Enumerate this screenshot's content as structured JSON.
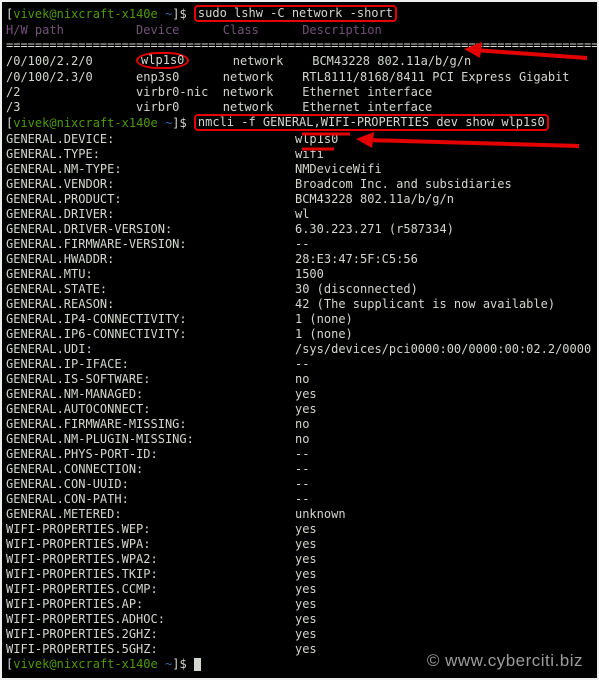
{
  "prompt1": {
    "user": "vivek",
    "host": "nixcraft-x140e",
    "dir": "~",
    "cmd": "sudo lshw -C network -short"
  },
  "lshw": {
    "header": {
      "hwpath": "H/W path",
      "device": "Device",
      "class": "Class",
      "desc": "Description"
    },
    "rows": [
      {
        "hwpath": "/0/100/2.2/0",
        "device": "wlp1s0",
        "class": "network",
        "desc": "BCM43228 802.11a/b/g/n",
        "hilite_dev": true
      },
      {
        "hwpath": "/0/100/2.3/0",
        "device": "enp3s0",
        "class": "network",
        "desc": "RTL8111/8168/8411 PCI Express Gigabit"
      },
      {
        "hwpath": "/2",
        "device": "virbr0-nic",
        "class": "network",
        "desc": "Ethernet interface"
      },
      {
        "hwpath": "/3",
        "device": "virbr0",
        "class": "network",
        "desc": "Ethernet interface"
      }
    ]
  },
  "prompt2": {
    "user": "vivek",
    "host": "nixcraft-x140e",
    "dir": "~",
    "cmd": "nmcli -f GENERAL,WIFI-PROPERTIES dev show wlp1s0"
  },
  "nmcli": [
    {
      "k": "GENERAL.DEVICE:",
      "v": "wlp1s0",
      "hilite_v": true
    },
    {
      "k": "GENERAL.TYPE:",
      "v": "wifi",
      "hilite_v": true
    },
    {
      "k": "GENERAL.NM-TYPE:",
      "v": "NMDeviceWifi"
    },
    {
      "k": "GENERAL.VENDOR:",
      "v": "Broadcom Inc. and subsidiaries"
    },
    {
      "k": "GENERAL.PRODUCT:",
      "v": "BCM43228 802.11a/b/g/n"
    },
    {
      "k": "GENERAL.DRIVER:",
      "v": "wl"
    },
    {
      "k": "GENERAL.DRIVER-VERSION:",
      "v": "6.30.223.271 (r587334)"
    },
    {
      "k": "GENERAL.FIRMWARE-VERSION:",
      "v": "--"
    },
    {
      "k": "GENERAL.HWADDR:",
      "v": "28:E3:47:5F:C5:56"
    },
    {
      "k": "GENERAL.MTU:",
      "v": "1500"
    },
    {
      "k": "GENERAL.STATE:",
      "v": "30 (disconnected)"
    },
    {
      "k": "GENERAL.REASON:",
      "v": "42 (The supplicant is now available)"
    },
    {
      "k": "GENERAL.IP4-CONNECTIVITY:",
      "v": "1 (none)"
    },
    {
      "k": "GENERAL.IP6-CONNECTIVITY:",
      "v": "1 (none)"
    },
    {
      "k": "GENERAL.UDI:",
      "v": "/sys/devices/pci0000:00/0000:00:02.2/0000"
    },
    {
      "k": "GENERAL.IP-IFACE:",
      "v": "--"
    },
    {
      "k": "GENERAL.IS-SOFTWARE:",
      "v": "no"
    },
    {
      "k": "GENERAL.NM-MANAGED:",
      "v": "yes"
    },
    {
      "k": "GENERAL.AUTOCONNECT:",
      "v": "yes"
    },
    {
      "k": "GENERAL.FIRMWARE-MISSING:",
      "v": "no"
    },
    {
      "k": "GENERAL.NM-PLUGIN-MISSING:",
      "v": "no"
    },
    {
      "k": "GENERAL.PHYS-PORT-ID:",
      "v": "--"
    },
    {
      "k": "GENERAL.CONNECTION:",
      "v": "--"
    },
    {
      "k": "GENERAL.CON-UUID:",
      "v": "--"
    },
    {
      "k": "GENERAL.CON-PATH:",
      "v": "--"
    },
    {
      "k": "GENERAL.METERED:",
      "v": "unknown"
    },
    {
      "k": "WIFI-PROPERTIES.WEP:",
      "v": "yes"
    },
    {
      "k": "WIFI-PROPERTIES.WPA:",
      "v": "yes"
    },
    {
      "k": "WIFI-PROPERTIES.WPA2:",
      "v": "yes"
    },
    {
      "k": "WIFI-PROPERTIES.TKIP:",
      "v": "yes"
    },
    {
      "k": "WIFI-PROPERTIES.CCMP:",
      "v": "yes"
    },
    {
      "k": "WIFI-PROPERTIES.AP:",
      "v": "yes"
    },
    {
      "k": "WIFI-PROPERTIES.ADHOC:",
      "v": "yes"
    },
    {
      "k": "WIFI-PROPERTIES.2GHZ:",
      "v": "yes"
    },
    {
      "k": "WIFI-PROPERTIES.5GHZ:",
      "v": "yes"
    }
  ],
  "prompt3": {
    "user": "vivek",
    "host": "nixcraft-x140e",
    "dir": "~"
  },
  "watermark": "©  www.cyberciti.biz",
  "ruler": "=================================================================================="
}
